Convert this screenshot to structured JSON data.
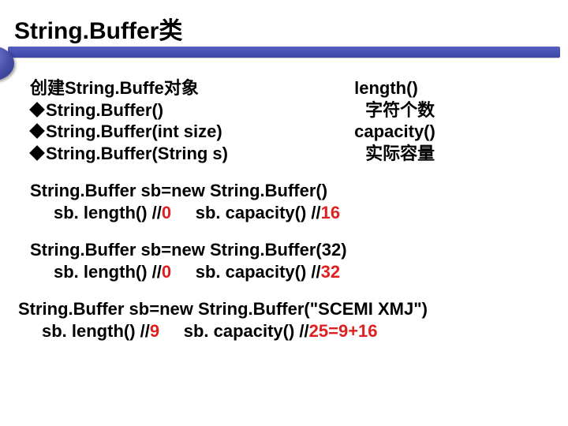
{
  "title": "String.Buffer类",
  "left": {
    "heading": "创建String.Buffe对象",
    "b1": "String.Buffer()",
    "b2": "String.Buffer(int size)",
    "b3": "String.Buffer(String s)"
  },
  "right": {
    "l1": "length()",
    "l1d": "字符个数",
    "l2": "capacity()",
    "l2d": "实际容量"
  },
  "ex1": {
    "line1": "String.Buffer sb=new String.Buffer()",
    "pre_a": "sb. length() //",
    "val_a": "0",
    "mid": "     sb. capacity() //",
    "val_b": "16"
  },
  "ex2": {
    "line1": "String.Buffer sb=new String.Buffer(32)",
    "pre_a": "sb. length() //",
    "val_a": "0",
    "mid": "     sb. capacity() //",
    "val_b": "32"
  },
  "ex3": {
    "line1": "String.Buffer sb=new String.Buffer(\"SCEMI XMJ\")",
    "pre_a": "sb. length() //",
    "val_a": "9",
    "mid": "     sb. capacity() //",
    "val_b": "25=9+16"
  }
}
